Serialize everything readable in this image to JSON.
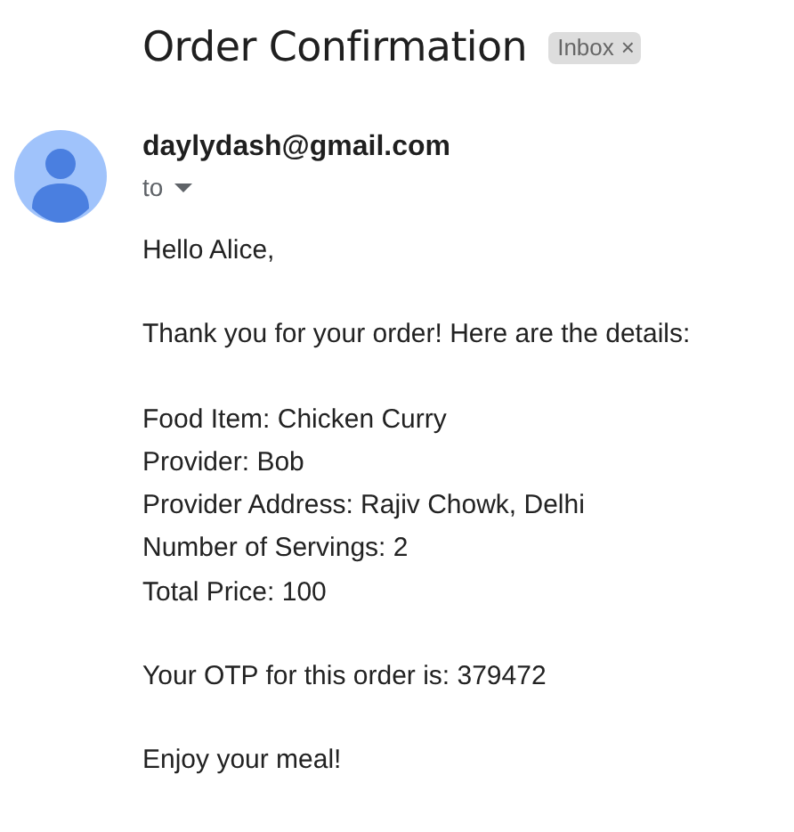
{
  "subject": {
    "title": "Order Confirmation",
    "label": {
      "text": "Inbox",
      "close": "×"
    }
  },
  "message": {
    "sender": "daylydash@gmail.com",
    "recipient_toggle": {
      "text": "to",
      "expanded": false
    },
    "body": [
      [
        "Hello Alice,"
      ],
      [
        "Thank you for your order! Here are the details:"
      ],
      [
        "Food Item: Chicken Curry",
        "Provider: Bob",
        "Provider Address: Rajiv Chowk, Delhi",
        "Number of Servings: 2",
        "Total Price: 100"
      ],
      [
        "Your OTP for this order is: 379472"
      ],
      [
        "Enjoy your meal!"
      ]
    ]
  }
}
